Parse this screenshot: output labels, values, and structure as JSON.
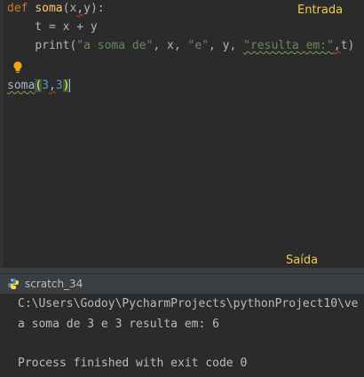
{
  "editor": {
    "line1": {
      "kw": "def",
      "name": "soma",
      "open": "(",
      "p1": "x",
      "comma": ",",
      "p2": "y",
      "close": "):"
    },
    "line2": {
      "text": "    t = x + y"
    },
    "line3": {
      "indent": "    ",
      "call": "print",
      "open": "(",
      "s1": "\"a soma de\"",
      "sep1": ", x, ",
      "s2": "\"e\"",
      "sep2": ", y, ",
      "s3": "\"resulta em:\"",
      "comma": ",",
      "rest": "t)"
    },
    "line4": {
      "name": "soma",
      "open": "(",
      "a": "3",
      "comma": ",",
      "b": "3",
      "close": ")"
    }
  },
  "annotations": {
    "input_label": "Entrada",
    "output_label": "Saída"
  },
  "run_tab": {
    "label": "scratch_34",
    "icon": "python-icon"
  },
  "console": {
    "cmd": "C:\\Users\\Godoy\\PycharmProjects\\pythonProject10\\ve",
    "output": "a soma de 3 e 3 resulta em: 6",
    "exit": "Process finished with exit code 0"
  }
}
